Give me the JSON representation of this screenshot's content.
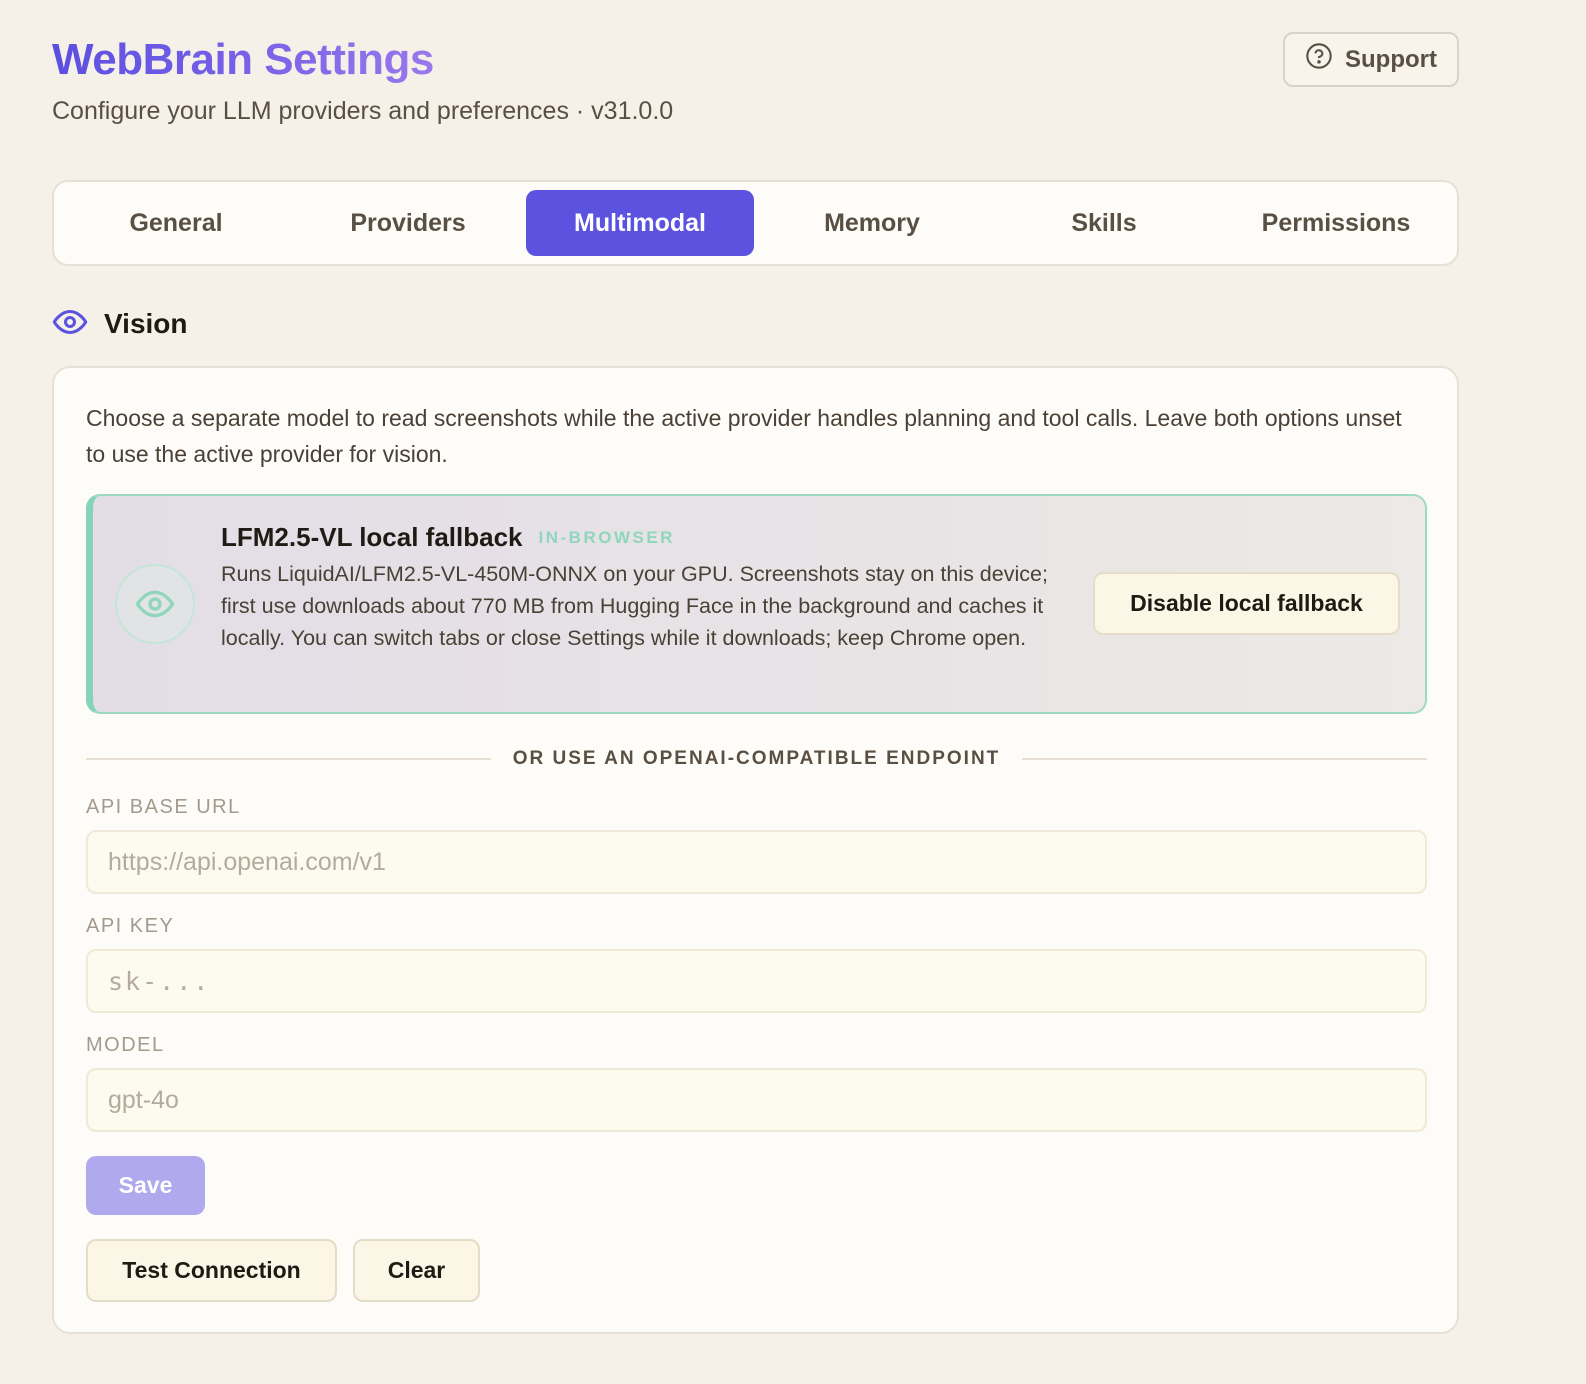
{
  "header": {
    "title": "WebBrain Settings",
    "subtitle": "Configure your LLM providers and preferences · v31.0.0",
    "support_label": "Support"
  },
  "tabs": [
    {
      "label": "General",
      "active": false
    },
    {
      "label": "Providers",
      "active": false
    },
    {
      "label": "Multimodal",
      "active": true
    },
    {
      "label": "Memory",
      "active": false
    },
    {
      "label": "Skills",
      "active": false
    },
    {
      "label": "Permissions",
      "active": false
    }
  ],
  "vision": {
    "section_title": "Vision",
    "description": "Choose a separate model to read screenshots while the active provider handles planning and tool calls. Leave both options unset to use the active provider for vision.",
    "fallback": {
      "title": "LFM2.5-VL local fallback",
      "badge": "IN-BROWSER",
      "description": "Runs LiquidAI/LFM2.5-VL-450M-ONNX on your GPU. Screenshots stay on this device; first use downloads about 770 MB from Hugging Face in the background and caches it locally. You can switch tabs or close Settings while it downloads; keep Chrome open.",
      "button_label": "Disable local fallback"
    },
    "divider_label": "OR USE AN OPENAI-COMPATIBLE ENDPOINT",
    "fields": {
      "base_url": {
        "label": "API BASE URL",
        "placeholder": "https://api.openai.com/v1",
        "value": ""
      },
      "api_key": {
        "label": "API KEY",
        "placeholder": "sk-...",
        "value": ""
      },
      "model": {
        "label": "MODEL",
        "placeholder": "gpt-4o",
        "value": ""
      }
    },
    "save_label": "Save",
    "test_label": "Test Connection",
    "clear_label": "Clear"
  },
  "colors": {
    "accent": "#5b52e0",
    "fallback_accent": "#86d3ba",
    "background": "#f5f1e8"
  },
  "icons": {
    "support": "help-circle-icon",
    "section": "eye-icon",
    "fallback": "eye-icon"
  }
}
